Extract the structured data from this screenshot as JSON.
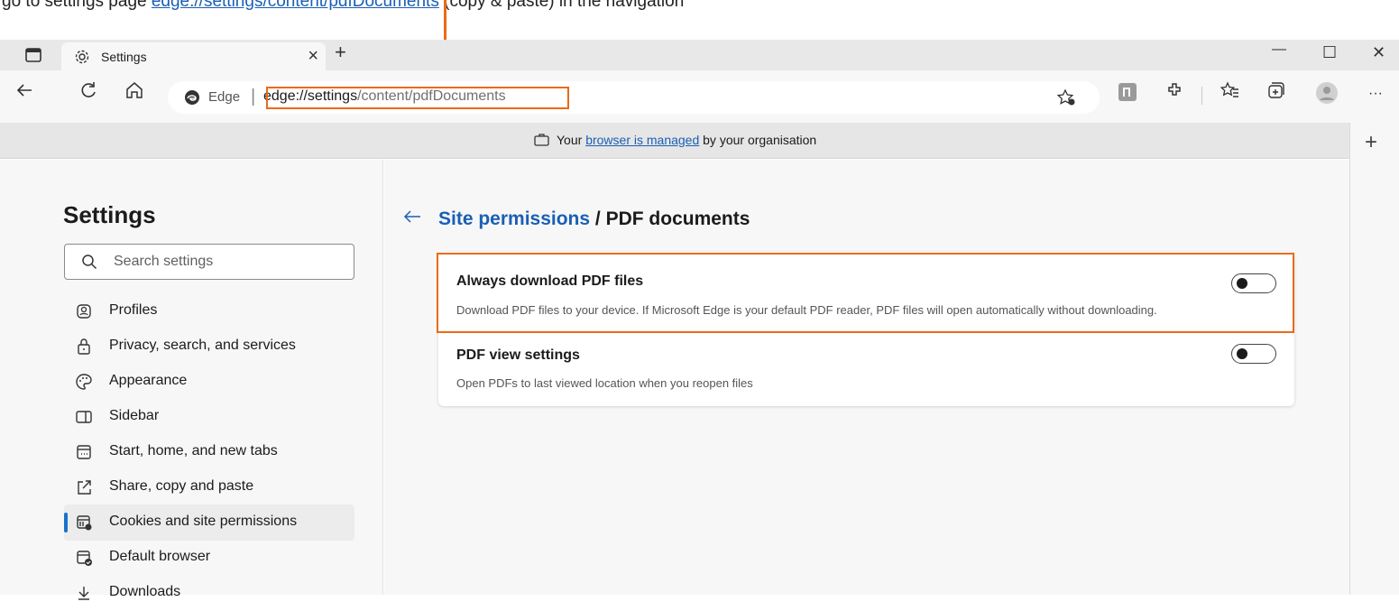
{
  "instruction": {
    "text_before": "g",
    "link_text": "edge://settings/content/pdfDocuments",
    "text_after": " (copy & paste) in the navigation"
  },
  "browser": {
    "tab_title": "Settings",
    "tab_close": "×",
    "new_tab": "+",
    "window_controls": {
      "minimize": "—",
      "maximize": "☐",
      "close": "✕"
    },
    "brand": "Edge",
    "url_bold": "edge://settings",
    "url_rest": "/content/pdfDocuments",
    "more": "···",
    "accent_color": "#ec6a16"
  },
  "managed_bar": {
    "prefix": "Your ",
    "link": "browser is managed",
    "suffix": " by your organisation"
  },
  "right_rail": {
    "add": "+"
  },
  "sidebar": {
    "title": "Settings",
    "search_placeholder": "Search settings",
    "items": [
      {
        "label": "Profiles",
        "icon": "profile-icon"
      },
      {
        "label": "Privacy, search, and services",
        "icon": "lock-icon"
      },
      {
        "label": "Appearance",
        "icon": "palette-icon"
      },
      {
        "label": "Sidebar",
        "icon": "sidebar-icon"
      },
      {
        "label": "Start, home, and new tabs",
        "icon": "home-tab-icon"
      },
      {
        "label": "Share, copy and paste",
        "icon": "share-icon"
      },
      {
        "label": "Cookies and site permissions",
        "icon": "cookie-icon",
        "active": true
      },
      {
        "label": "Default browser",
        "icon": "default-browser-icon"
      },
      {
        "label": "Downloads",
        "icon": "download-icon"
      }
    ]
  },
  "main": {
    "breadcrumb_link": "Site permissions",
    "breadcrumb_sep": " / ",
    "breadcrumb_current": "PDF documents",
    "settings": [
      {
        "title": "Always download PDF files",
        "description": "Download PDF files to your device. If Microsoft Edge is your default PDF reader, PDF files will open automatically without downloading.",
        "enabled": false
      },
      {
        "title": "PDF view settings",
        "description": "Open PDFs to last viewed location when you reopen files",
        "enabled": false
      }
    ]
  }
}
